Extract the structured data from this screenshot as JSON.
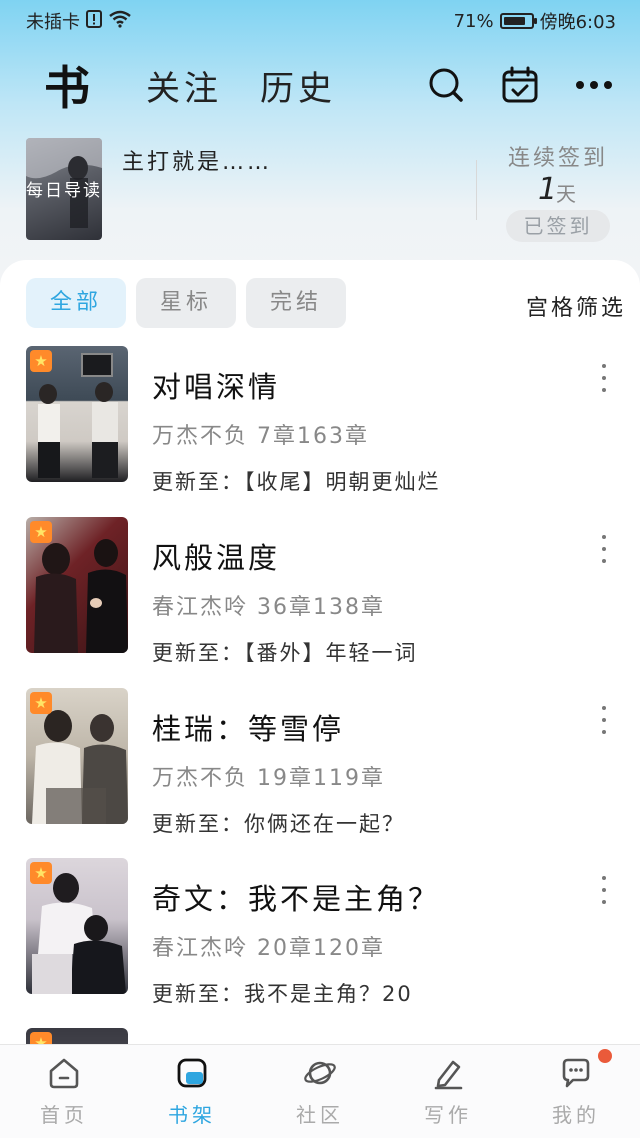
{
  "status_bar": {
    "carrier": "未插卡",
    "battery": "71%",
    "time": "傍晚6:03"
  },
  "header": {
    "tabs": [
      {
        "label": "书"
      },
      {
        "label": "关注"
      },
      {
        "label": "历史"
      }
    ],
    "icons": [
      "search-icon",
      "calendar-check-icon",
      "more-icon"
    ]
  },
  "daily": {
    "cover_label": "每日导读",
    "text": "主打就是……",
    "signin_title": "连续签到",
    "signin_days": "1",
    "signin_unit": "天",
    "signin_button": "已签到"
  },
  "filters": {
    "chips": [
      "全部",
      "星标",
      "完结"
    ],
    "active": "全部",
    "grid_filter": "宫格筛选"
  },
  "books": [
    {
      "title": "对唱深情",
      "meta": "万杰不负  7章163章",
      "update": "更新至：【收尾】明朝更灿烂",
      "starred": true,
      "cover_colors": [
        "#d9d6d2",
        "#4d5a6a"
      ]
    },
    {
      "title": "风般温度",
      "meta": "春江杰呤  36章138章",
      "update": "更新至：【番外】年轻一词",
      "starred": true,
      "cover_colors": [
        "#5a1f22",
        "#b8b0ab"
      ]
    },
    {
      "title": "桂瑞：等雪停",
      "meta": "万杰不负  19章119章",
      "update": "更新至：你俩还在一起？",
      "starred": true,
      "cover_colors": [
        "#cfc7bb",
        "#5a5a58"
      ]
    },
    {
      "title": "奇文：我不是主角？",
      "meta": "春江杰呤  20章120章",
      "update": "更新至：我不是主角？20",
      "starred": true,
      "cover_colors": [
        "#d8d0d6",
        "#2d2f38"
      ]
    }
  ],
  "bottom_nav": {
    "items": [
      {
        "label": "首页",
        "icon": "home-icon"
      },
      {
        "label": "书架",
        "icon": "bookshelf-icon"
      },
      {
        "label": "社区",
        "icon": "planet-icon"
      },
      {
        "label": "写作",
        "icon": "pen-icon"
      },
      {
        "label": "我的",
        "icon": "chat-bubble-icon"
      }
    ],
    "active": "书架"
  },
  "colors": {
    "accent": "#2fa6e0",
    "badge": "#ff8a2a",
    "notification": "#ea5a3a"
  }
}
